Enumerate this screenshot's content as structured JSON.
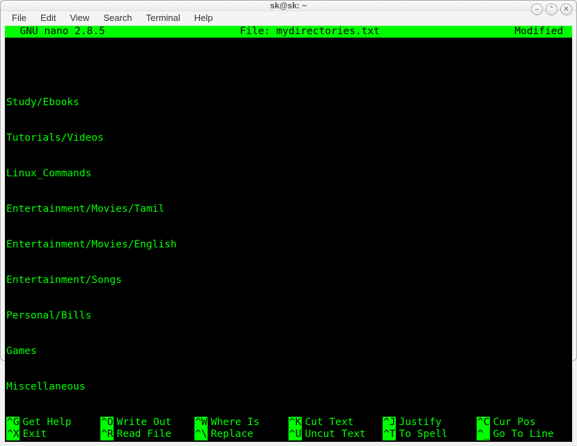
{
  "window": {
    "title": "sk@sk: ~",
    "controls": {
      "minimize": "–",
      "maximize": "⌃",
      "close": "✕"
    }
  },
  "menubar": {
    "items": [
      "File",
      "Edit",
      "View",
      "Search",
      "Terminal",
      "Help"
    ]
  },
  "nano": {
    "header": {
      "version": "  GNU nano 2.8.5",
      "filename": "File: mydirectories.txt",
      "status": "Modified "
    },
    "file_lines": [
      "Study/Ebooks",
      "Tutorials/Videos",
      "Linux_Commands",
      "Entertainment/Movies/Tamil",
      "Entertainment/Movies/English",
      "Entertainment/Songs",
      "Personal/Bills",
      "Games",
      "Miscellaneous"
    ],
    "shortcuts": [
      {
        "key": "^G",
        "label": "Get Help"
      },
      {
        "key": "^O",
        "label": "Write Out"
      },
      {
        "key": "^W",
        "label": "Where Is"
      },
      {
        "key": "^K",
        "label": "Cut Text"
      },
      {
        "key": "^J",
        "label": "Justify"
      },
      {
        "key": "^C",
        "label": "Cur Pos"
      },
      {
        "key": "^X",
        "label": "Exit"
      },
      {
        "key": "^R",
        "label": "Read File"
      },
      {
        "key": "^\\",
        "label": "Replace"
      },
      {
        "key": "^U",
        "label": "Uncut Text"
      },
      {
        "key": "^T",
        "label": "To Spell"
      },
      {
        "key": "^_",
        "label": "Go To Line"
      }
    ]
  }
}
